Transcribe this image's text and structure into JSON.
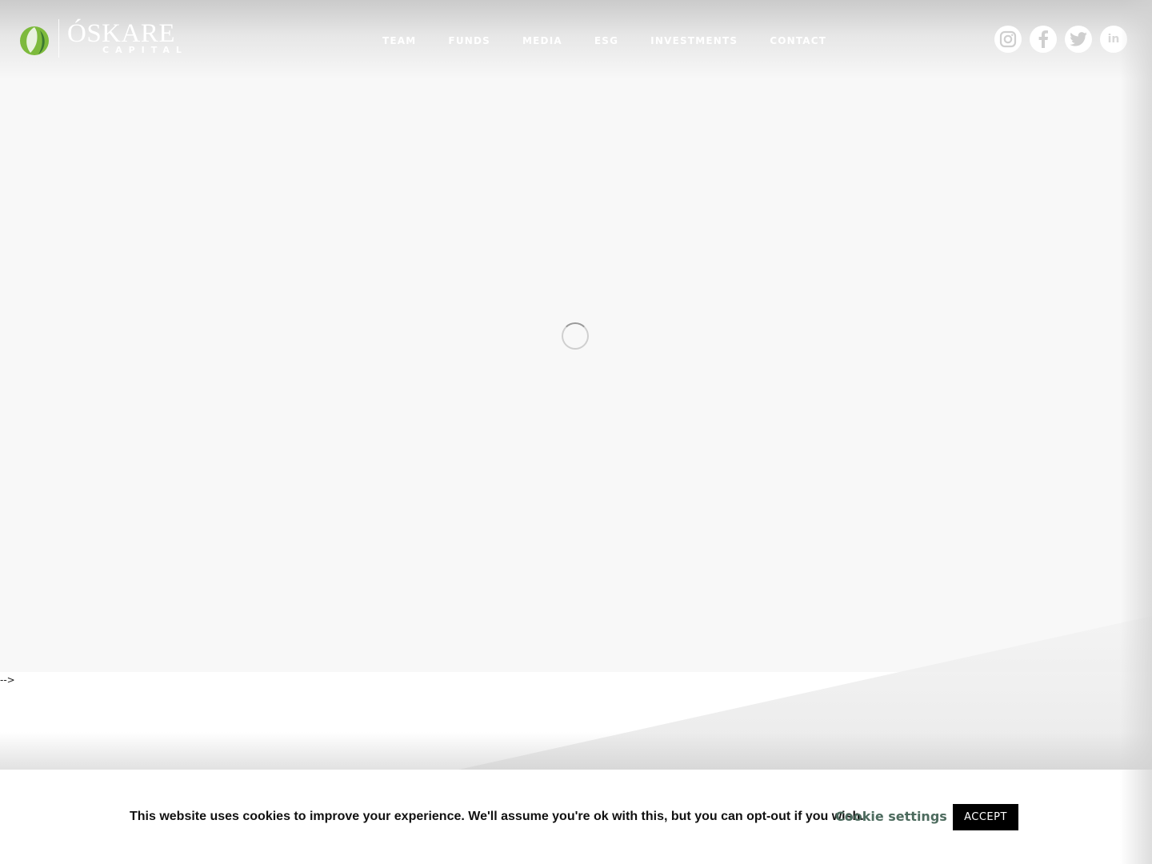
{
  "brand": {
    "name": "ÓSKARE",
    "sub": "CAPITAL"
  },
  "nav": {
    "items": [
      {
        "label": "TEAM"
      },
      {
        "label": "FUNDS"
      },
      {
        "label": "MEDIA"
      },
      {
        "label": "ESG"
      },
      {
        "label": "INVESTMENTS"
      },
      {
        "label": "CONTACT"
      }
    ]
  },
  "social": {
    "icons": [
      "instagram-icon",
      "facebook-icon",
      "twitter-icon",
      "linkedin-icon"
    ],
    "linkedin_text": "in"
  },
  "stray_text": "-->",
  "cookie": {
    "message": "This website uses cookies to improve your experience. We'll assume you're ok with this, but you can opt-out if you wish.",
    "settings_label": "Cookie settings",
    "accept_label": "ACCEPT"
  },
  "colors": {
    "brand_green": "#7dba3c",
    "cookie_settings": "#4d6b5e",
    "accept_bg": "#000000"
  }
}
